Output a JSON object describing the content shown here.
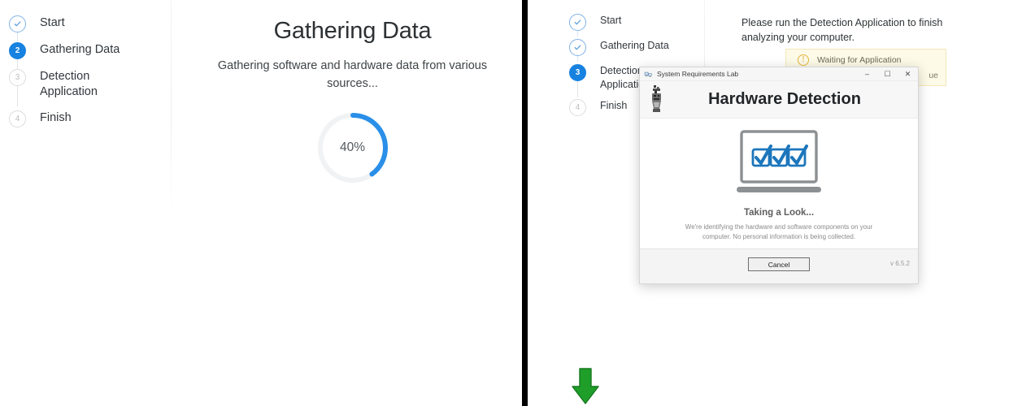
{
  "colors": {
    "accent_blue": "#1782e0",
    "progress_track": "#f1f2f4",
    "done_outline": "#7fb3e8",
    "todo_outline": "#dcdcdc",
    "notice_bg": "#fdfae8",
    "notice_border": "#f3e8b8",
    "warning_amber": "#e5b53c",
    "arrow_green": "#1f9e29",
    "panel_divider": "#000000",
    "laptop_gray": "#8d9093",
    "checkbox_blue": "#1c76bc"
  },
  "left_panel": {
    "steps": [
      {
        "number": "1",
        "label": "Start",
        "state": "done",
        "icon": "check-icon"
      },
      {
        "number": "2",
        "label": "Gathering Data",
        "state": "active",
        "icon": ""
      },
      {
        "number": "3",
        "label": "Detection Application",
        "state": "todo",
        "icon": ""
      },
      {
        "number": "4",
        "label": "Finish",
        "state": "todo",
        "icon": ""
      }
    ],
    "title": "Gathering Data",
    "subtitle": "Gathering software and hardware data from various sources...",
    "progress": {
      "percent_label": "40%",
      "percent_value": 40
    }
  },
  "right_panel": {
    "steps": [
      {
        "number": "1",
        "label": "Start",
        "state": "done",
        "icon": "check-icon"
      },
      {
        "number": "2",
        "label": "Gathering Data",
        "state": "done",
        "icon": "check-icon"
      },
      {
        "number": "3",
        "label": "Detection Application",
        "state": "active",
        "icon": ""
      },
      {
        "number": "4",
        "label": "Finish",
        "state": "todo",
        "icon": ""
      }
    ],
    "instruction": "Please run the Detection Application to finish analyzing your computer.",
    "notice": {
      "icon": "warning-icon",
      "text": "Waiting for Application",
      "link_text": "ue"
    },
    "arrow": {
      "icon": "arrow-down-icon"
    }
  },
  "dialog": {
    "app_icon": "system-requirements-lab-icon",
    "app_title": "System Requirements Lab",
    "window_buttons": {
      "minimize": "–",
      "maximize": "☐",
      "close": "✕"
    },
    "hand_icon": "hand-cursor-icon",
    "heading": "Hardware Detection",
    "illustration": "laptop-with-checkmarks-icon",
    "status_title": "Taking a Look...",
    "status_description": "We're identifying the hardware and software components on your computer. No personal information is being collected.",
    "cancel_label": "Cancel",
    "version": "v 6.5.2"
  }
}
